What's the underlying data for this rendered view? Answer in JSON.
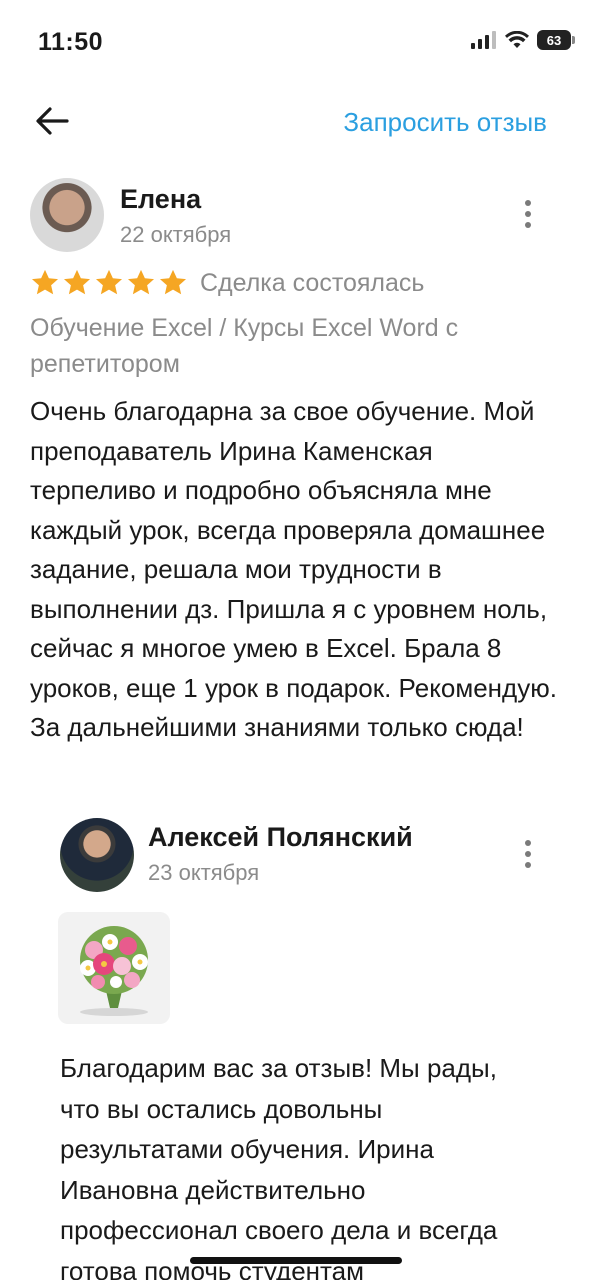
{
  "status_bar": {
    "time": "11:50",
    "battery": "63"
  },
  "nav": {
    "back_icon": "arrow-left-icon",
    "request_review_label": "Запросить отзыв"
  },
  "review": {
    "author": "Елена",
    "date": "22 октября",
    "rating": 5,
    "deal_status": "Сделка состоялась",
    "service": "Обучение Excel / Курсы Excel Word с репетитором",
    "text": "Очень благодарна за свое обучение. Мой преподаватель Ирина Каменская терпеливо и подробно объясняла мне каждый урок, всегда проверяла домашнее задание, решала мои трудности в выполнении дз. Пришла я с уровнем ноль, сейчас я многое умею в Excel. Брала 8 уроков, еще 1 урок в подарок. Рекомендую. За дальнейшими знаниями только сюда!"
  },
  "reply": {
    "author": "Алексей Полянский",
    "date": "23 октября",
    "text": "Благодарим вас за отзыв! Мы рады, что вы остались довольны результатами обучения. Ирина Ивановна действительно профессионал своего дела и всегда готова помочь студентам"
  },
  "colors": {
    "accent": "#2b9fe0",
    "star": "#f5a623",
    "secondary_text": "#8b8b8b"
  }
}
